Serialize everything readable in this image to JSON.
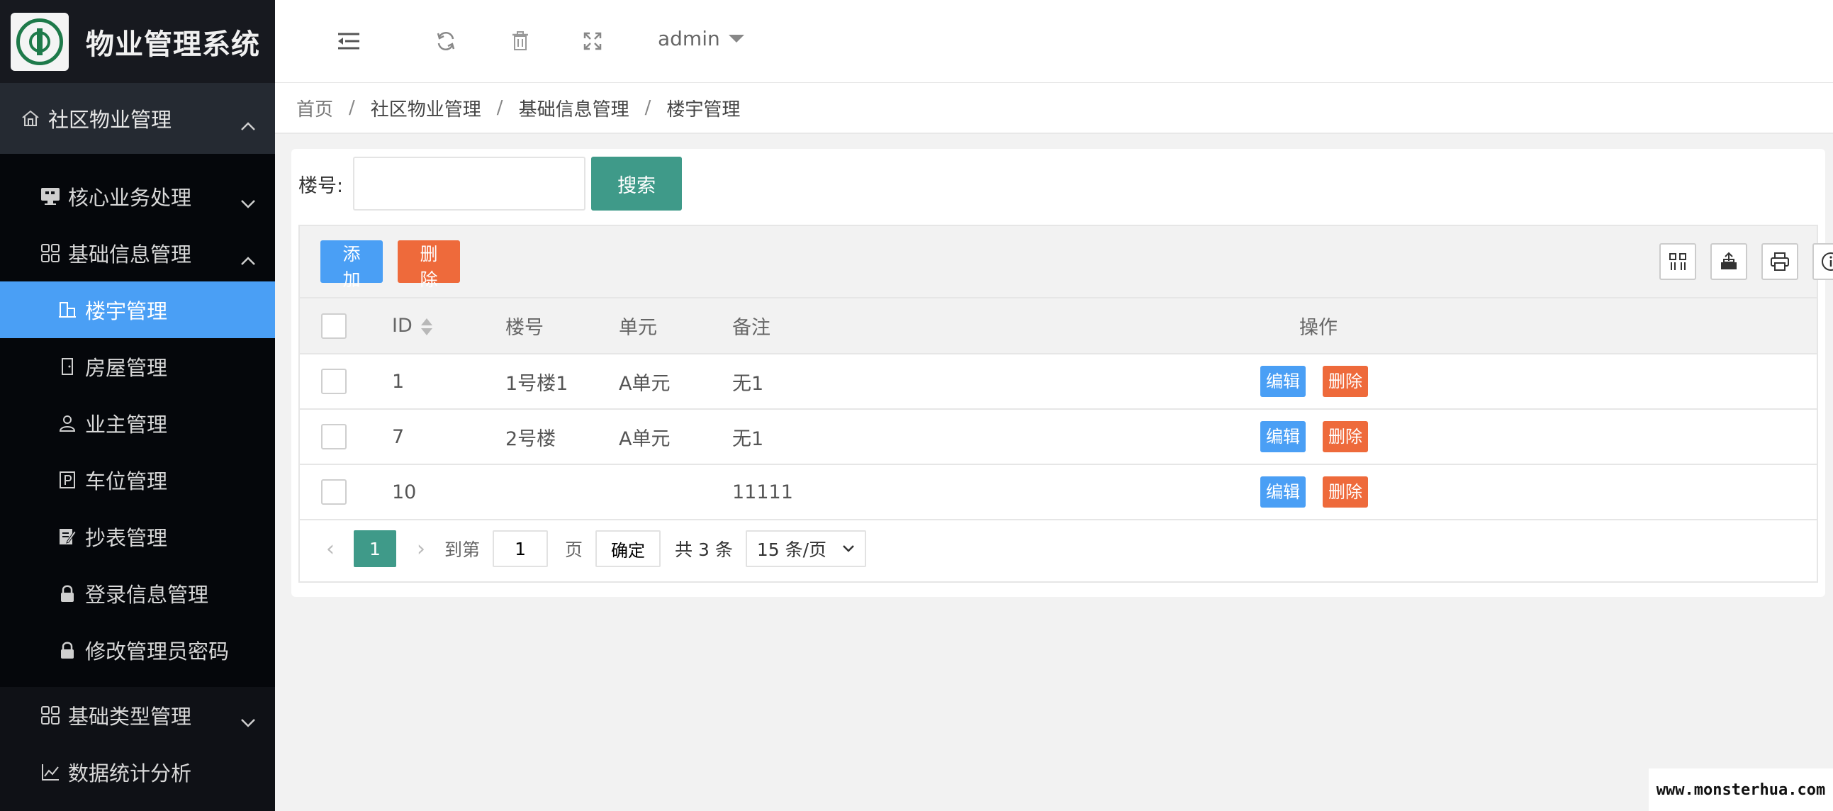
{
  "app": {
    "title": "物业管理系统"
  },
  "sidebar": {
    "top_item": "社区物业管理",
    "items": [
      {
        "label": "核心业务处理",
        "level": 1
      },
      {
        "label": "基础信息管理",
        "level": 1
      },
      {
        "label": "楼宇管理",
        "level": 2,
        "active": true
      },
      {
        "label": "房屋管理",
        "level": 2
      },
      {
        "label": "业主管理",
        "level": 2
      },
      {
        "label": "车位管理",
        "level": 2
      },
      {
        "label": "抄表管理",
        "level": 2
      },
      {
        "label": "登录信息管理",
        "level": 2
      },
      {
        "label": "修改管理员密码",
        "level": 2
      },
      {
        "label": "基础类型管理",
        "level": 1
      },
      {
        "label": "数据统计分析",
        "level": 1
      }
    ]
  },
  "header": {
    "user": "admin"
  },
  "breadcrumb": [
    "首页",
    "社区物业管理",
    "基础信息管理",
    "楼宇管理"
  ],
  "search": {
    "label": "楼号:",
    "value": "",
    "button": "搜索"
  },
  "toolbar": {
    "add": "添加",
    "delete": "删除"
  },
  "table": {
    "columns": [
      "ID",
      "楼号",
      "单元",
      "备注",
      "操作"
    ],
    "rows": [
      {
        "id": "1",
        "building": "1号楼1",
        "unit": "A单元",
        "remark": "无1"
      },
      {
        "id": "7",
        "building": "2号楼",
        "unit": "A单元",
        "remark": "无1"
      },
      {
        "id": "10",
        "building": "",
        "unit": "",
        "remark": "11111"
      }
    ],
    "edit_label": "编辑",
    "delete_label": "删除"
  },
  "pagination": {
    "current_page": "1",
    "goto_label": "到第",
    "page_value": "1",
    "page_suffix": "页",
    "confirm": "确定",
    "total": "共 3 条",
    "page_size": "15 条/页"
  },
  "watermark": "www.monsterhua.com",
  "colors": {
    "accent": "#3f9a89",
    "primary": "#4a9ff5",
    "danger": "#ee6a3b",
    "sidebar_bg": "#0f1116"
  }
}
